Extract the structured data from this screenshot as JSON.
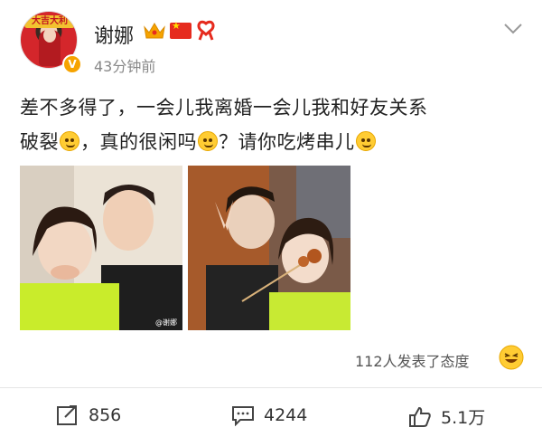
{
  "user": {
    "name": "谢娜",
    "post_time": "43分钟前",
    "avatar_banner": "大吉大利",
    "verified_mark": "V"
  },
  "post": {
    "line1": "差不多得了，一会儿我离婚一会儿我和好友关系",
    "line2_part1": "破裂",
    "line2_part2": "，真的很闲吗",
    "line2_part3": "？请你吃烤串儿"
  },
  "images": {
    "left_watermark": "@谢娜"
  },
  "reactions": {
    "text": "112人发表了态度"
  },
  "actions": {
    "repost_count": "856",
    "comment_count": "4244",
    "like_count": "5.1万"
  },
  "colors": {
    "accent_gold": "#f6a300",
    "text_primary": "#222222",
    "text_secondary": "#888888",
    "flag_red": "#e62b1e"
  },
  "icons": {
    "crown": "crown-icon",
    "flag": "china-flag-icon",
    "ribbon": "ribbon-icon",
    "chevron": "chevron-down-icon",
    "repost": "repost-icon",
    "comment": "comment-icon",
    "like": "thumbs-up-icon",
    "laugh": "laugh-emoji-icon"
  }
}
